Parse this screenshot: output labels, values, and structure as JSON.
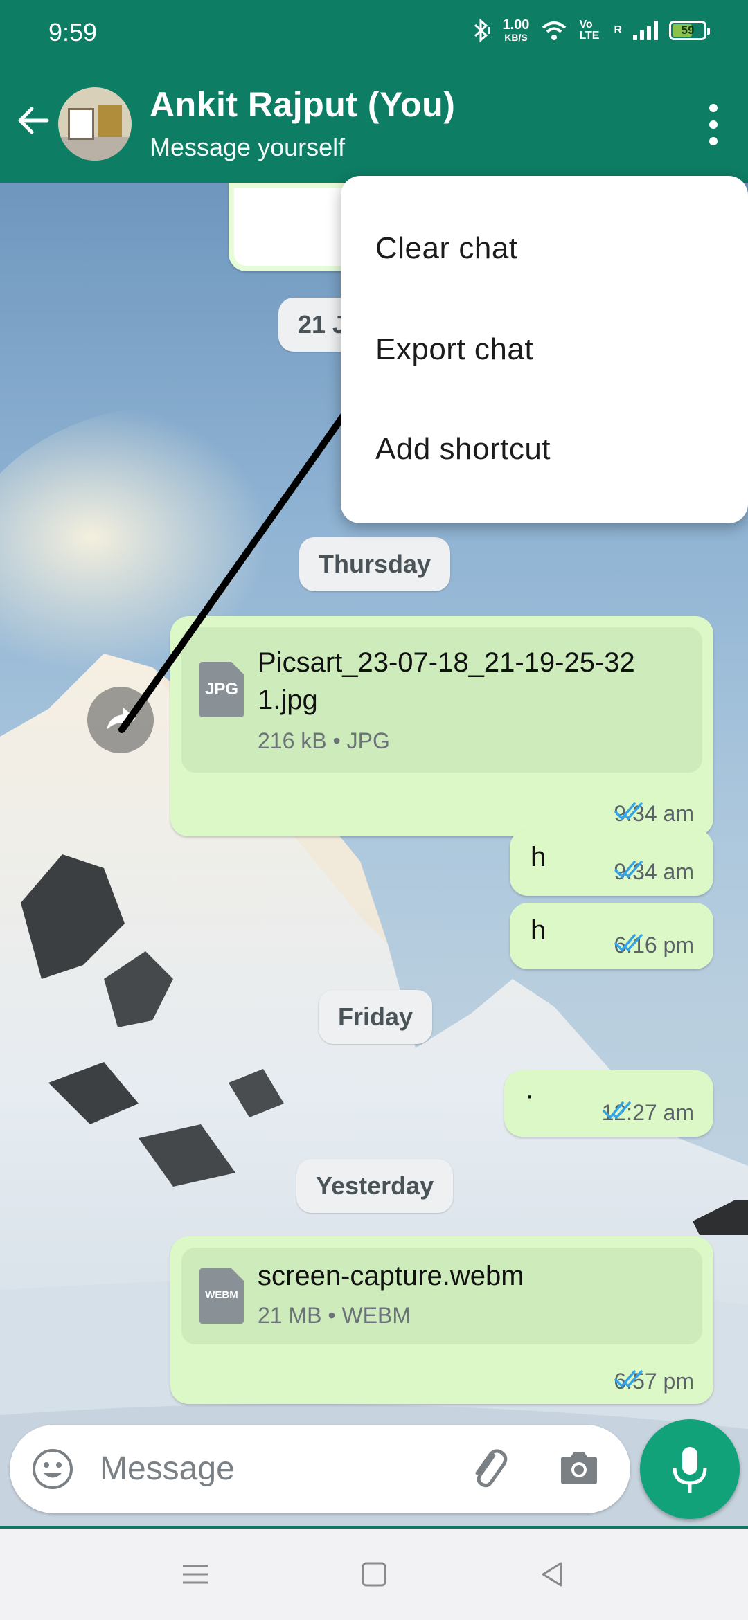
{
  "status_bar": {
    "time": "9:59",
    "net_speed_value": "1.00",
    "net_speed_unit": "KB/S",
    "volte_label": "Vo LTE",
    "roaming_label": "R",
    "battery_level": "59"
  },
  "header": {
    "title": "Ankit Rajput (You)",
    "subtitle": "Message yourself"
  },
  "menu": {
    "items": [
      {
        "label": "Clear chat"
      },
      {
        "label": "Export chat"
      },
      {
        "label": "Add shortcut"
      }
    ]
  },
  "chat": {
    "partial_date_chip": "21 J",
    "date_thursday": "Thursday",
    "date_friday": "Friday",
    "date_yesterday": "Yesterday",
    "file1": {
      "icon_label": "JPG",
      "name_line1": "Picsart_23-07-18_21-19-25-32",
      "name_line2": "1.jpg",
      "meta": "216 kB • JPG",
      "time": "9:34 am"
    },
    "msg_h1": {
      "text": "h",
      "time": "9:34 am"
    },
    "msg_h2": {
      "text": "h",
      "time": "6:16 pm"
    },
    "msg_dot": {
      "text": "·",
      "time": "12:27 am"
    },
    "file2": {
      "icon_label": "WEBM",
      "name": "screen-capture.webm",
      "meta": "21 MB • WEBM",
      "time": "6:57 pm"
    }
  },
  "composer": {
    "placeholder": "Message"
  },
  "colors": {
    "header": "#0d7d64",
    "bubble": "#dcf8c6",
    "tick_blue": "#34a4e6",
    "mic": "#12a27a"
  }
}
